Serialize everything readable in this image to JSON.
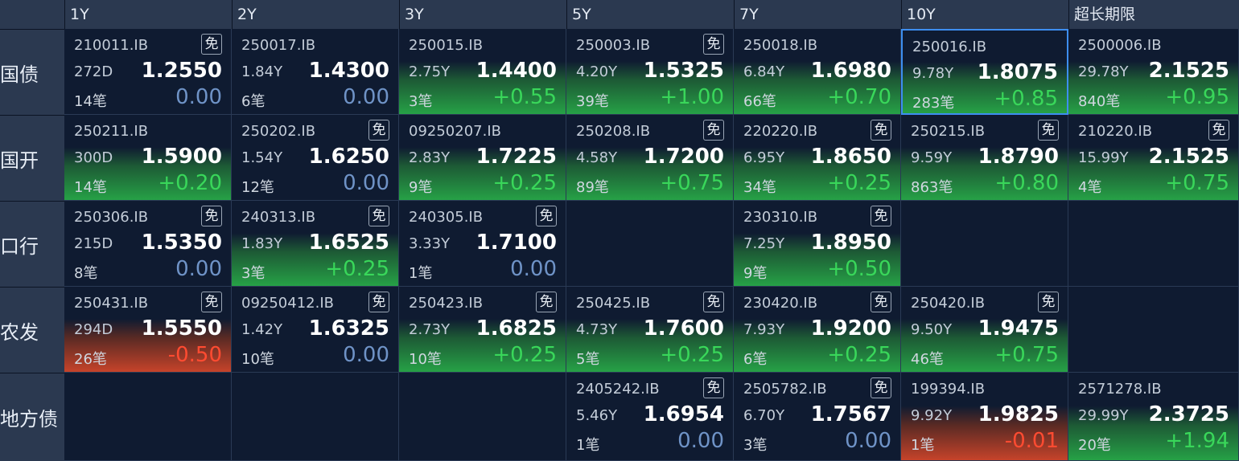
{
  "columns": [
    "1Y",
    "2Y",
    "3Y",
    "5Y",
    "7Y",
    "10Y",
    "超长期限"
  ],
  "rows": [
    {
      "label": "国债",
      "cells": [
        {
          "code": "210011.IB",
          "mian": true,
          "term": "272D",
          "yield": "1.2550",
          "count": "14笔",
          "change": "0.00",
          "trend": "zero"
        },
        {
          "code": "250017.IB",
          "mian": false,
          "term": "1.84Y",
          "yield": "1.4300",
          "count": "6笔",
          "change": "0.00",
          "trend": "zero"
        },
        {
          "code": "250015.IB",
          "mian": false,
          "term": "2.75Y",
          "yield": "1.4400",
          "count": "3笔",
          "change": "+0.55",
          "trend": "pos"
        },
        {
          "code": "250003.IB",
          "mian": true,
          "term": "4.20Y",
          "yield": "1.5325",
          "count": "39笔",
          "change": "+1.00",
          "trend": "pos"
        },
        {
          "code": "250018.IB",
          "mian": false,
          "term": "6.84Y",
          "yield": "1.6980",
          "count": "66笔",
          "change": "+0.70",
          "trend": "pos"
        },
        {
          "code": "250016.IB",
          "mian": false,
          "term": "9.78Y",
          "yield": "1.8075",
          "count": "283笔",
          "change": "+0.85",
          "trend": "pos",
          "selected": true
        },
        {
          "code": "2500006.IB",
          "mian": false,
          "term": "29.78Y",
          "yield": "2.1525",
          "count": "840笔",
          "change": "+0.95",
          "trend": "pos"
        }
      ]
    },
    {
      "label": "国开",
      "cells": [
        {
          "code": "250211.IB",
          "mian": false,
          "term": "300D",
          "yield": "1.5900",
          "count": "14笔",
          "change": "+0.20",
          "trend": "pos"
        },
        {
          "code": "250202.IB",
          "mian": true,
          "term": "1.54Y",
          "yield": "1.6250",
          "count": "12笔",
          "change": "0.00",
          "trend": "zero"
        },
        {
          "code": "09250207.IB",
          "mian": false,
          "term": "2.83Y",
          "yield": "1.7225",
          "count": "9笔",
          "change": "+0.25",
          "trend": "pos"
        },
        {
          "code": "250208.IB",
          "mian": true,
          "term": "4.58Y",
          "yield": "1.7200",
          "count": "89笔",
          "change": "+0.75",
          "trend": "pos"
        },
        {
          "code": "220220.IB",
          "mian": true,
          "term": "6.95Y",
          "yield": "1.8650",
          "count": "34笔",
          "change": "+0.25",
          "trend": "pos"
        },
        {
          "code": "250215.IB",
          "mian": true,
          "term": "9.59Y",
          "yield": "1.8790",
          "count": "863笔",
          "change": "+0.80",
          "trend": "pos"
        },
        {
          "code": "210220.IB",
          "mian": true,
          "term": "15.99Y",
          "yield": "2.1525",
          "count": "4笔",
          "change": "+0.75",
          "trend": "pos"
        }
      ]
    },
    {
      "label": "口行",
      "cells": [
        {
          "code": "250306.IB",
          "mian": true,
          "term": "215D",
          "yield": "1.5350",
          "count": "8笔",
          "change": "0.00",
          "trend": "zero"
        },
        {
          "code": "240313.IB",
          "mian": true,
          "term": "1.83Y",
          "yield": "1.6525",
          "count": "3笔",
          "change": "+0.25",
          "trend": "pos"
        },
        {
          "code": "240305.IB",
          "mian": true,
          "term": "3.33Y",
          "yield": "1.7100",
          "count": "1笔",
          "change": "0.00",
          "trend": "zero"
        },
        null,
        {
          "code": "230310.IB",
          "mian": true,
          "term": "7.25Y",
          "yield": "1.8950",
          "count": "9笔",
          "change": "+0.50",
          "trend": "pos"
        },
        null,
        null
      ]
    },
    {
      "label": "农发",
      "cells": [
        {
          "code": "250431.IB",
          "mian": true,
          "term": "294D",
          "yield": "1.5550",
          "count": "26笔",
          "change": "-0.50",
          "trend": "neg"
        },
        {
          "code": "09250412.IB",
          "mian": true,
          "term": "1.42Y",
          "yield": "1.6325",
          "count": "10笔",
          "change": "0.00",
          "trend": "zero"
        },
        {
          "code": "250423.IB",
          "mian": true,
          "term": "2.73Y",
          "yield": "1.6825",
          "count": "10笔",
          "change": "+0.25",
          "trend": "pos"
        },
        {
          "code": "250425.IB",
          "mian": true,
          "term": "4.73Y",
          "yield": "1.7600",
          "count": "5笔",
          "change": "+0.25",
          "trend": "pos"
        },
        {
          "code": "230420.IB",
          "mian": true,
          "term": "7.93Y",
          "yield": "1.9200",
          "count": "6笔",
          "change": "+0.25",
          "trend": "pos"
        },
        {
          "code": "250420.IB",
          "mian": true,
          "term": "9.50Y",
          "yield": "1.9475",
          "count": "46笔",
          "change": "+0.75",
          "trend": "pos"
        },
        null
      ]
    },
    {
      "label": "地方债",
      "cells": [
        null,
        null,
        null,
        {
          "code": "2405242.IB",
          "mian": true,
          "term": "5.46Y",
          "yield": "1.6954",
          "count": "1笔",
          "change": "0.00",
          "trend": "zero"
        },
        {
          "code": "2505782.IB",
          "mian": true,
          "term": "6.70Y",
          "yield": "1.7567",
          "count": "3笔",
          "change": "0.00",
          "trend": "zero"
        },
        {
          "code": "199394.IB",
          "mian": false,
          "term": "9.92Y",
          "yield": "1.9825",
          "count": "1笔",
          "change": "-0.01",
          "trend": "neg"
        },
        {
          "code": "2571278.IB",
          "mian": false,
          "term": "29.99Y",
          "yield": "2.3725",
          "count": "20笔",
          "change": "+1.94",
          "trend": "pos"
        }
      ]
    }
  ],
  "mian_label": "免",
  "colors": {
    "background": "#0f1a2e",
    "header": "#2b3950",
    "positive": "#39d75a",
    "negative": "#ff4b31",
    "zero": "#6f93c7",
    "selected_border": "#3d8ef0"
  }
}
